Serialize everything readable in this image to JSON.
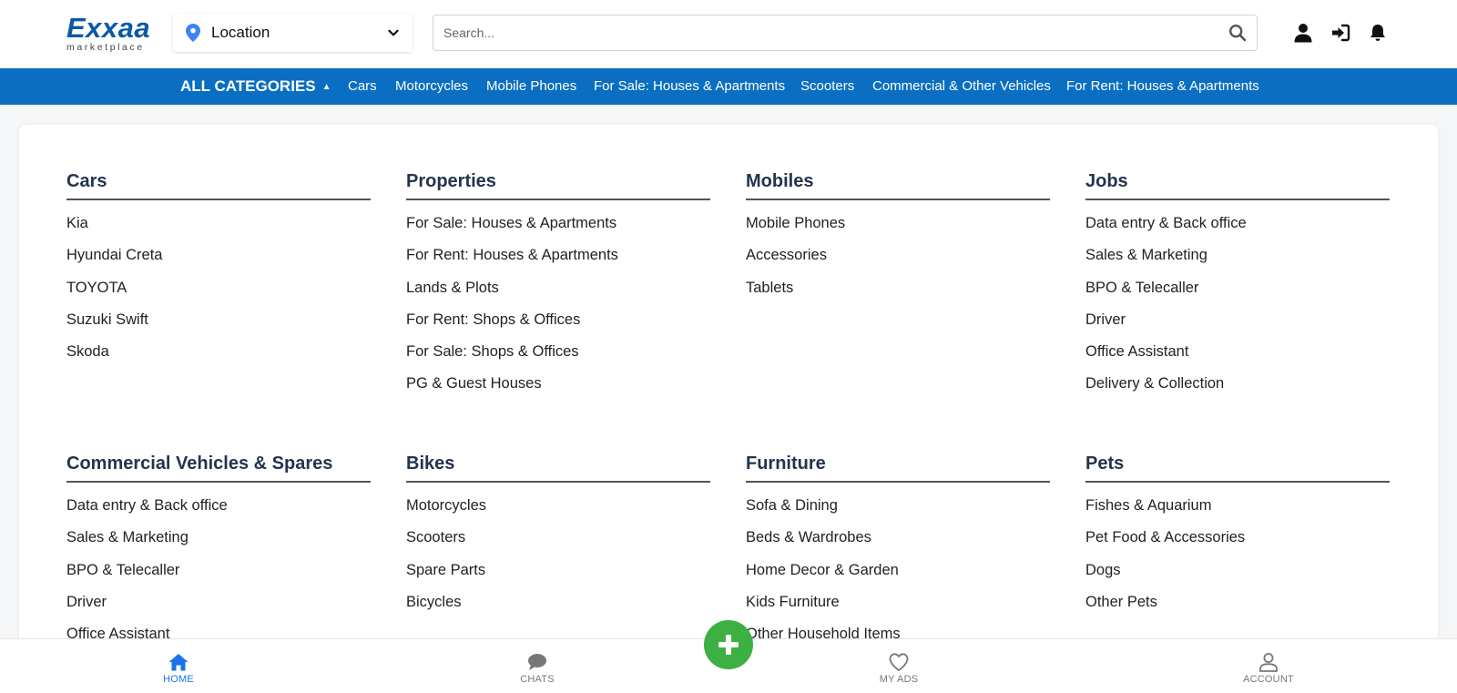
{
  "brand": {
    "name": "Exxaa",
    "tagline": "marketplace",
    "color": "#0a5aa6"
  },
  "location": {
    "label": "Location"
  },
  "search": {
    "placeholder": "Search..."
  },
  "catbar": {
    "all_label": "ALL CATEGORIES",
    "links": [
      "Cars",
      "Motorcycles",
      "Mobile Phones",
      "For Sale: Houses & Apartments",
      "Scooters",
      "Commercial & Other Vehicles",
      "For Rent: Houses & Apartments"
    ],
    "color": "#0a6fc2"
  },
  "menu": {
    "columns": [
      {
        "title": "Cars",
        "items": [
          "Kia",
          "Hyundai Creta",
          "TOYOTA",
          "Suzuki Swift",
          "Skoda"
        ]
      },
      {
        "title": "Properties",
        "items": [
          "For Sale: Houses & Apartments",
          "For Rent: Houses & Apartments",
          "Lands & Plots",
          "For Rent: Shops & Offices",
          "For Sale: Shops & Offices",
          "PG & Guest Houses"
        ]
      },
      {
        "title": "Mobiles",
        "items": [
          "Mobile Phones",
          "Accessories",
          "Tablets"
        ]
      },
      {
        "title": "Jobs",
        "items": [
          "Data entry & Back office",
          "Sales & Marketing",
          "BPO & Telecaller",
          "Driver",
          "Office Assistant",
          "Delivery & Collection"
        ]
      },
      {
        "title": "Commercial Vehicles & Spares",
        "items": [
          "Data entry & Back office",
          "Sales & Marketing",
          "BPO & Telecaller",
          "Driver",
          "Office Assistant"
        ]
      },
      {
        "title": "Bikes",
        "items": [
          "Motorcycles",
          "Scooters",
          "Spare Parts",
          "Bicycles"
        ]
      },
      {
        "title": "Furniture",
        "items": [
          "Sofa & Dining",
          "Beds & Wardrobes",
          "Home Decor & Garden",
          "Kids Furniture",
          "Other Household Items"
        ]
      },
      {
        "title": "Pets",
        "items": [
          "Fishes & Aquarium",
          "Pet Food & Accessories",
          "Dogs",
          "Other Pets"
        ]
      }
    ]
  },
  "bottom_nav": {
    "home": "HOME",
    "chats": "CHATS",
    "my_ads": "MY ADS",
    "account": "ACCOUNT",
    "active_color": "#1a73e8",
    "fab_color": "#3cb043"
  },
  "icons": {
    "location": "map-pin-icon",
    "chevron": "chevron-down-icon",
    "search": "search-icon",
    "user": "user-icon",
    "login": "login-icon",
    "bell": "bell-icon",
    "home": "home-icon",
    "chat": "chat-icon",
    "heart": "heart-icon",
    "account": "account-icon",
    "plus": "plus-icon"
  }
}
